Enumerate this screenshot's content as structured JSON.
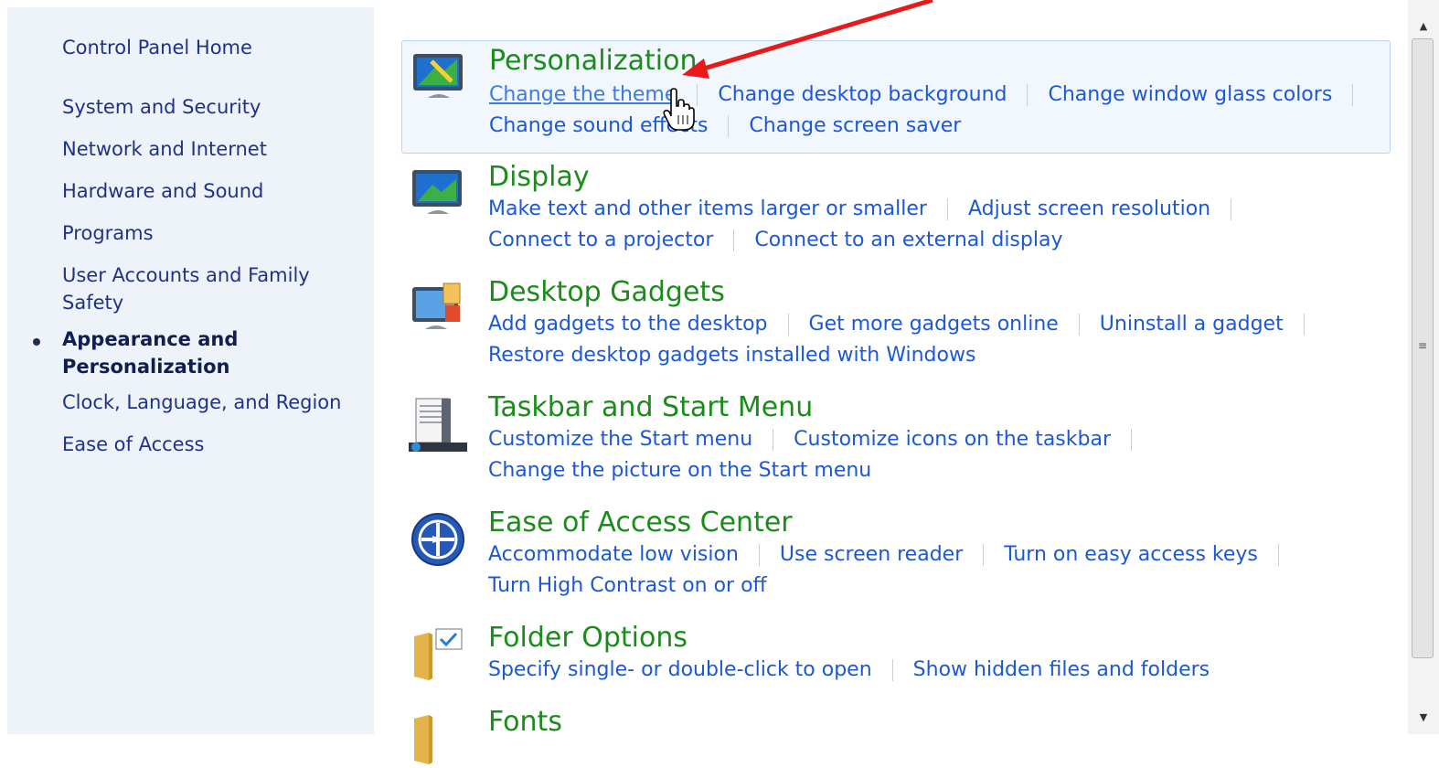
{
  "sidebar": {
    "home": "Control Panel Home",
    "items": [
      {
        "label": "System and Security"
      },
      {
        "label": "Network and Internet"
      },
      {
        "label": "Hardware and Sound"
      },
      {
        "label": "Programs"
      },
      {
        "label": "User Accounts and Family\nSafety"
      },
      {
        "label": "Appearance and\nPersonalization",
        "active": true
      },
      {
        "label": "Clock, Language, and Region"
      },
      {
        "label": "Ease of Access"
      }
    ]
  },
  "categories": [
    {
      "title": "Personalization",
      "icon": "personalization-icon",
      "links": [
        [
          "Change the theme",
          "Change desktop background",
          "Change window glass colors"
        ],
        [
          "Change sound effects",
          "Change screen saver"
        ]
      ]
    },
    {
      "title": "Display",
      "icon": "display-icon",
      "links": [
        [
          "Make text and other items larger or smaller",
          "Adjust screen resolution"
        ],
        [
          "Connect to a projector",
          "Connect to an external display"
        ]
      ]
    },
    {
      "title": "Desktop Gadgets",
      "icon": "gadgets-icon",
      "links": [
        [
          "Add gadgets to the desktop",
          "Get more gadgets online",
          "Uninstall a gadget"
        ],
        [
          "Restore desktop gadgets installed with Windows"
        ]
      ]
    },
    {
      "title": "Taskbar and Start Menu",
      "icon": "taskbar-icon",
      "links": [
        [
          "Customize the Start menu",
          "Customize icons on the taskbar"
        ],
        [
          "Change the picture on the Start menu"
        ]
      ]
    },
    {
      "title": "Ease of Access Center",
      "icon": "ease-of-access-icon",
      "links": [
        [
          "Accommodate low vision",
          "Use screen reader",
          "Turn on easy access keys"
        ],
        [
          "Turn High Contrast on or off"
        ]
      ]
    },
    {
      "title": "Folder Options",
      "icon": "folder-options-icon",
      "links": [
        [
          "Specify single- or double-click to open",
          "Show hidden files and folders"
        ]
      ]
    },
    {
      "title": "Fonts",
      "icon": "fonts-icon",
      "links": []
    }
  ],
  "colors": {
    "title_green": "#1b8c1b",
    "link_blue": "#1c58d6",
    "sidebar_bg": "#eef3fa",
    "annotation_red": "#e8191a"
  }
}
